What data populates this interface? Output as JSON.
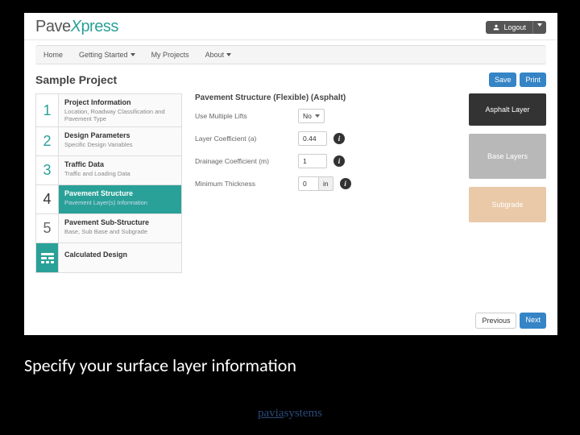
{
  "header": {
    "logo_pave": "Pave",
    "logo_x": "X",
    "logo_press": "press",
    "logout_label": "Logout"
  },
  "nav": {
    "home": "Home",
    "getting_started": "Getting Started",
    "my_projects": "My Projects",
    "about": "About"
  },
  "page": {
    "title": "Sample Project",
    "save_label": "Save",
    "print_label": "Print",
    "prev_label": "Previous",
    "next_label": "Next"
  },
  "sidebar": {
    "steps": [
      {
        "num": "1",
        "title": "Project Information",
        "sub": "Location, Roadway Classification and Pavement Type"
      },
      {
        "num": "2",
        "title": "Design Parameters",
        "sub": "Specific Design Variables"
      },
      {
        "num": "3",
        "title": "Traffic Data",
        "sub": "Traffic and Loading Data"
      },
      {
        "num": "4",
        "title": "Pavement Structure",
        "sub": "Pavement Layer(s) Information"
      },
      {
        "num": "5",
        "title": "Pavement Sub-Structure",
        "sub": "Base, Sub Base and Subgrade"
      }
    ],
    "calc_label": "Calculated Design"
  },
  "form": {
    "heading": "Pavement Structure (Flexible) (Asphalt)",
    "multiple_lifts_label": "Use Multiple Lifts",
    "multiple_lifts_value": "No",
    "layer_coef_label": "Layer Coefficient (a)",
    "layer_coef_value": "0.44",
    "drainage_label": "Drainage Coefficient (m)",
    "drainage_value": "1",
    "min_thickness_label": "Minimum Thickness",
    "min_thickness_value": "0",
    "min_thickness_unit": "in"
  },
  "layers": {
    "asphalt": "Asphalt Layer",
    "base": "Base Layers",
    "subgrade": "Subgrade"
  },
  "caption": "Specify your surface layer information",
  "brand": {
    "pavia": "pavia",
    "systems": "systems"
  }
}
